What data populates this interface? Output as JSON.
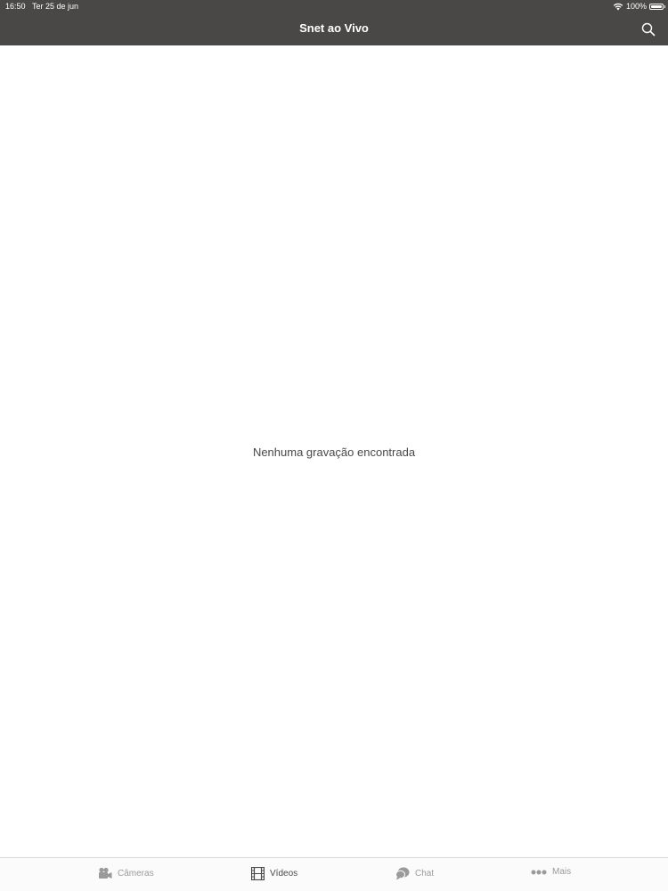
{
  "status_bar": {
    "time": "16:50",
    "date": "Ter 25 de jun",
    "battery": "100%"
  },
  "nav": {
    "title": "Snet ao Vivo"
  },
  "main": {
    "empty_message": "Nenhuma gravação encontrada"
  },
  "tabs": [
    {
      "label": "Câmeras",
      "icon": "camera-icon",
      "active": false
    },
    {
      "label": "Vídeos",
      "icon": "film-icon",
      "active": true
    },
    {
      "label": "Chat",
      "icon": "chat-icon",
      "active": false
    },
    {
      "label": "Mais",
      "icon": "more-icon",
      "active": false
    }
  ],
  "colors": {
    "nav_bg": "#4a4847",
    "tab_inactive": "#9a9a9a",
    "tab_active": "#4a4847"
  }
}
